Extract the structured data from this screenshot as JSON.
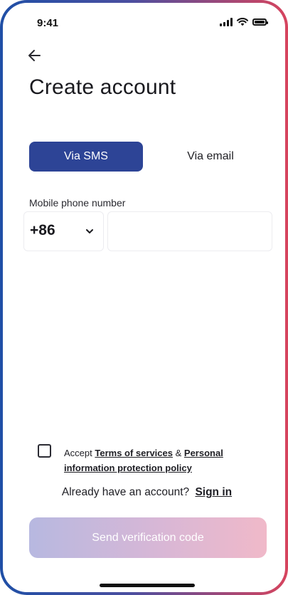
{
  "status_bar": {
    "time": "9:41"
  },
  "header": {
    "title": "Create account"
  },
  "tabs": [
    {
      "label": "Via SMS",
      "active": true
    },
    {
      "label": "Via email",
      "active": false
    }
  ],
  "phone": {
    "label": "Mobile phone number",
    "country_code": "+86",
    "value": ""
  },
  "terms": {
    "checked": false,
    "prefix": "Accept",
    "terms_link": "Terms of services",
    "connector": "&",
    "policy_link": "Personal information protection policy"
  },
  "signin": {
    "prompt": "Already have an account?",
    "link": "Sign in"
  },
  "send_button": {
    "label": "Send verification code",
    "enabled": false
  },
  "colors": {
    "primary": "#2d4496",
    "button_gradient": [
      "#b7b8e0",
      "#f0b9c9"
    ],
    "frame_gradient": [
      "#1f4fa6",
      "#d7445e"
    ]
  }
}
